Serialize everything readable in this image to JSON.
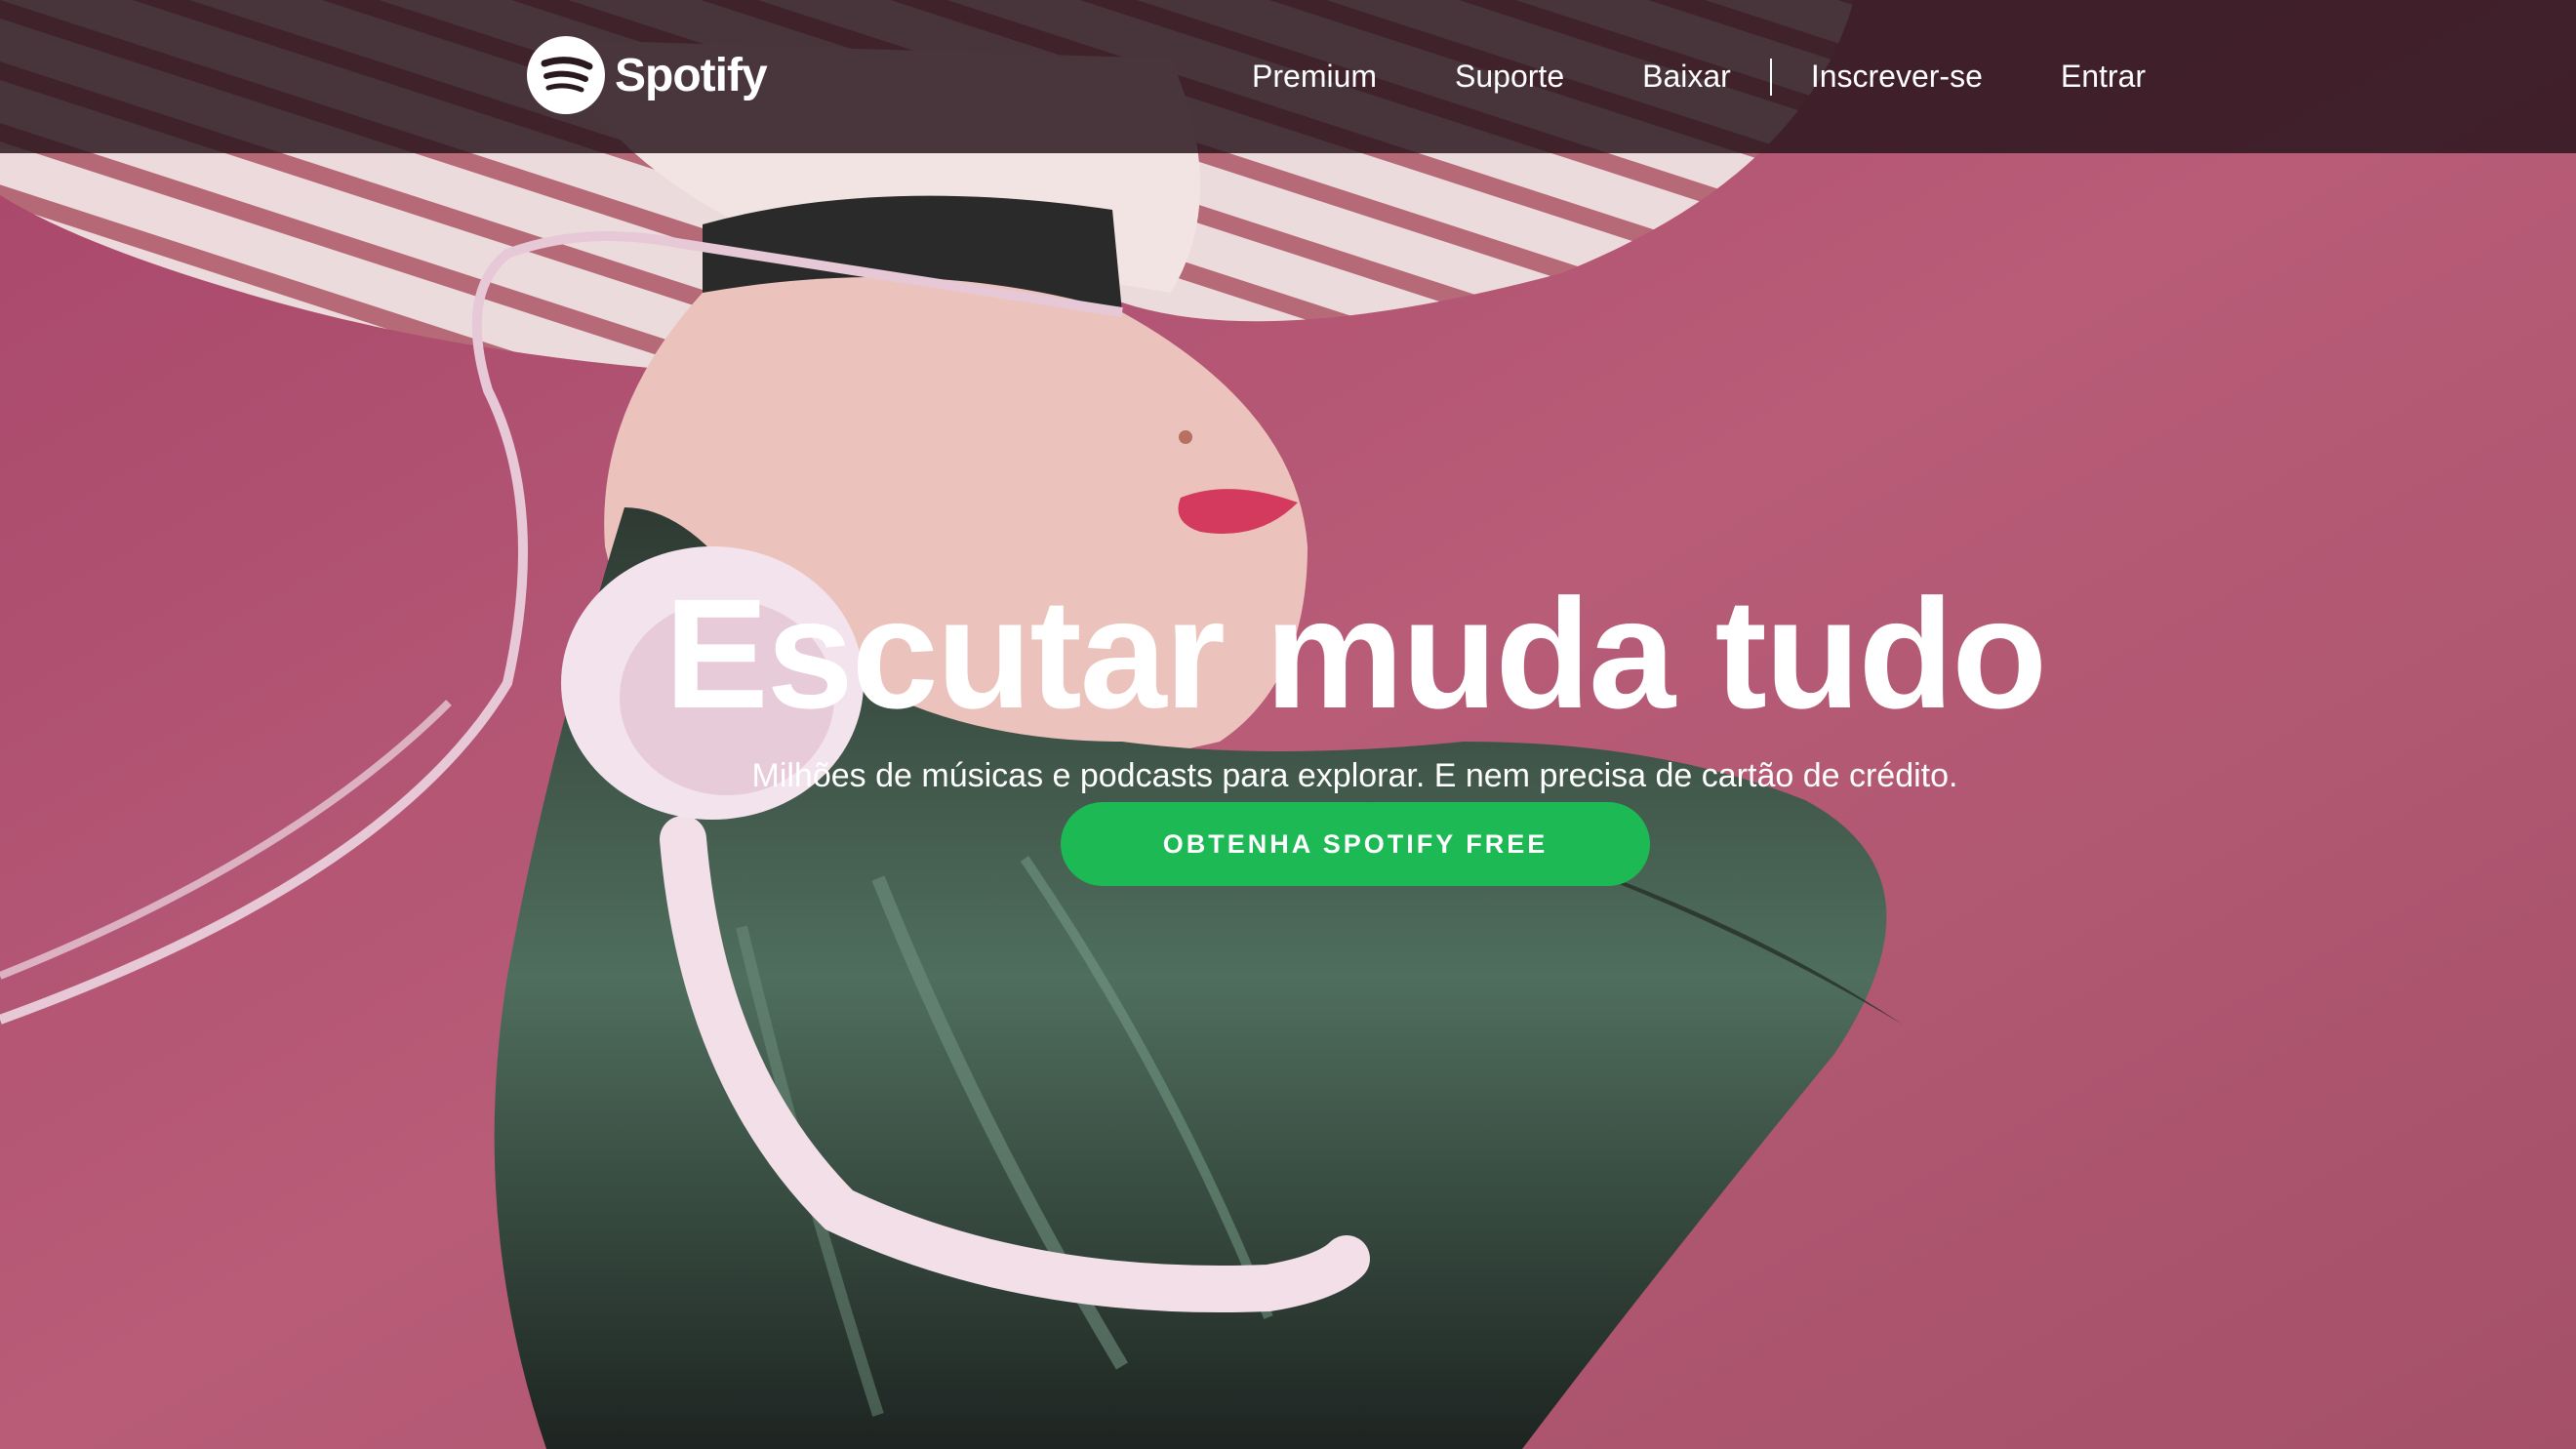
{
  "header": {
    "logo_text": "Spotify",
    "logo_icon": "spotify-logo-icon",
    "nav": [
      {
        "label": "Premium"
      },
      {
        "label": "Suporte"
      },
      {
        "label": "Baixar"
      },
      {
        "label": "Inscrever-se"
      },
      {
        "label": "Entrar"
      }
    ]
  },
  "hero": {
    "title": "Escutar muda tudo",
    "subtitle": "Milhões de músicas e podcasts para explorar. E nem precisa de cartão de crédito.",
    "cta_label": "OBTENHA SPOTIFY FREE"
  },
  "colors": {
    "background": "#b25a73",
    "navbar": "#28141c",
    "accent_green": "#1db954",
    "text": "#ffffff"
  }
}
